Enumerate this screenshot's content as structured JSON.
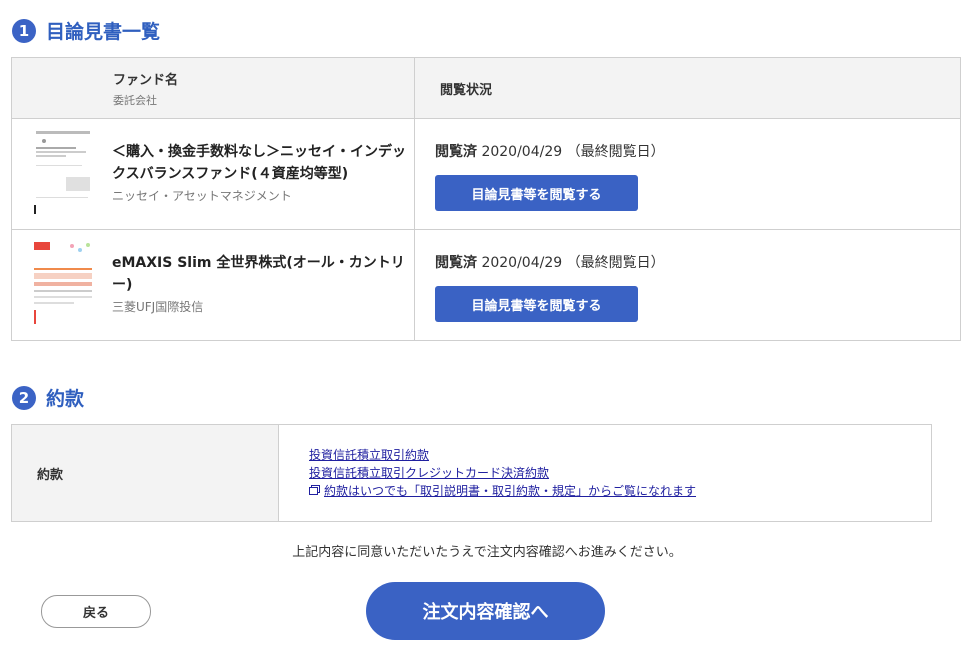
{
  "section1": {
    "number": "1",
    "title": "目論見書一覧"
  },
  "table": {
    "col_fund": "ファンド名",
    "col_company": "委託会社",
    "col_status": "閲覧状況"
  },
  "funds": [
    {
      "name": "＜購入・換金手数料なし＞ニッセイ・インデックスバランスファンド(４資産均等型)",
      "company": "ニッセイ・アセットマネジメント",
      "status_label": "閲覧済",
      "status_date": "2020/04/29",
      "status_note": "（最終閲覧日）",
      "button": "目論見書等を閲覧する"
    },
    {
      "name": "eMAXIS Slim 全世界株式(オール・カントリー)",
      "company": "三菱UFJ国際投信",
      "status_label": "閲覧済",
      "status_date": "2020/04/29",
      "status_note": "（最終閲覧日）",
      "button": "目論見書等を閲覧する"
    }
  ],
  "section2": {
    "number": "2",
    "title": "約款"
  },
  "terms": {
    "label": "約款",
    "links": [
      "投資信託積立取引約款",
      "投資信託積立取引クレジットカード決済約款",
      "約款はいつでも「取引説明書・取引約款・規定」からご覧になれます"
    ]
  },
  "agree_text": "上記内容に同意いただいたうえで注文内容確認へお進みください。",
  "back_button": "戻る",
  "confirm_button": "注文内容確認へ",
  "colors": {
    "accent": "#3a62c4",
    "link": "#2020a0",
    "header_bg": "#f3f3f3"
  }
}
